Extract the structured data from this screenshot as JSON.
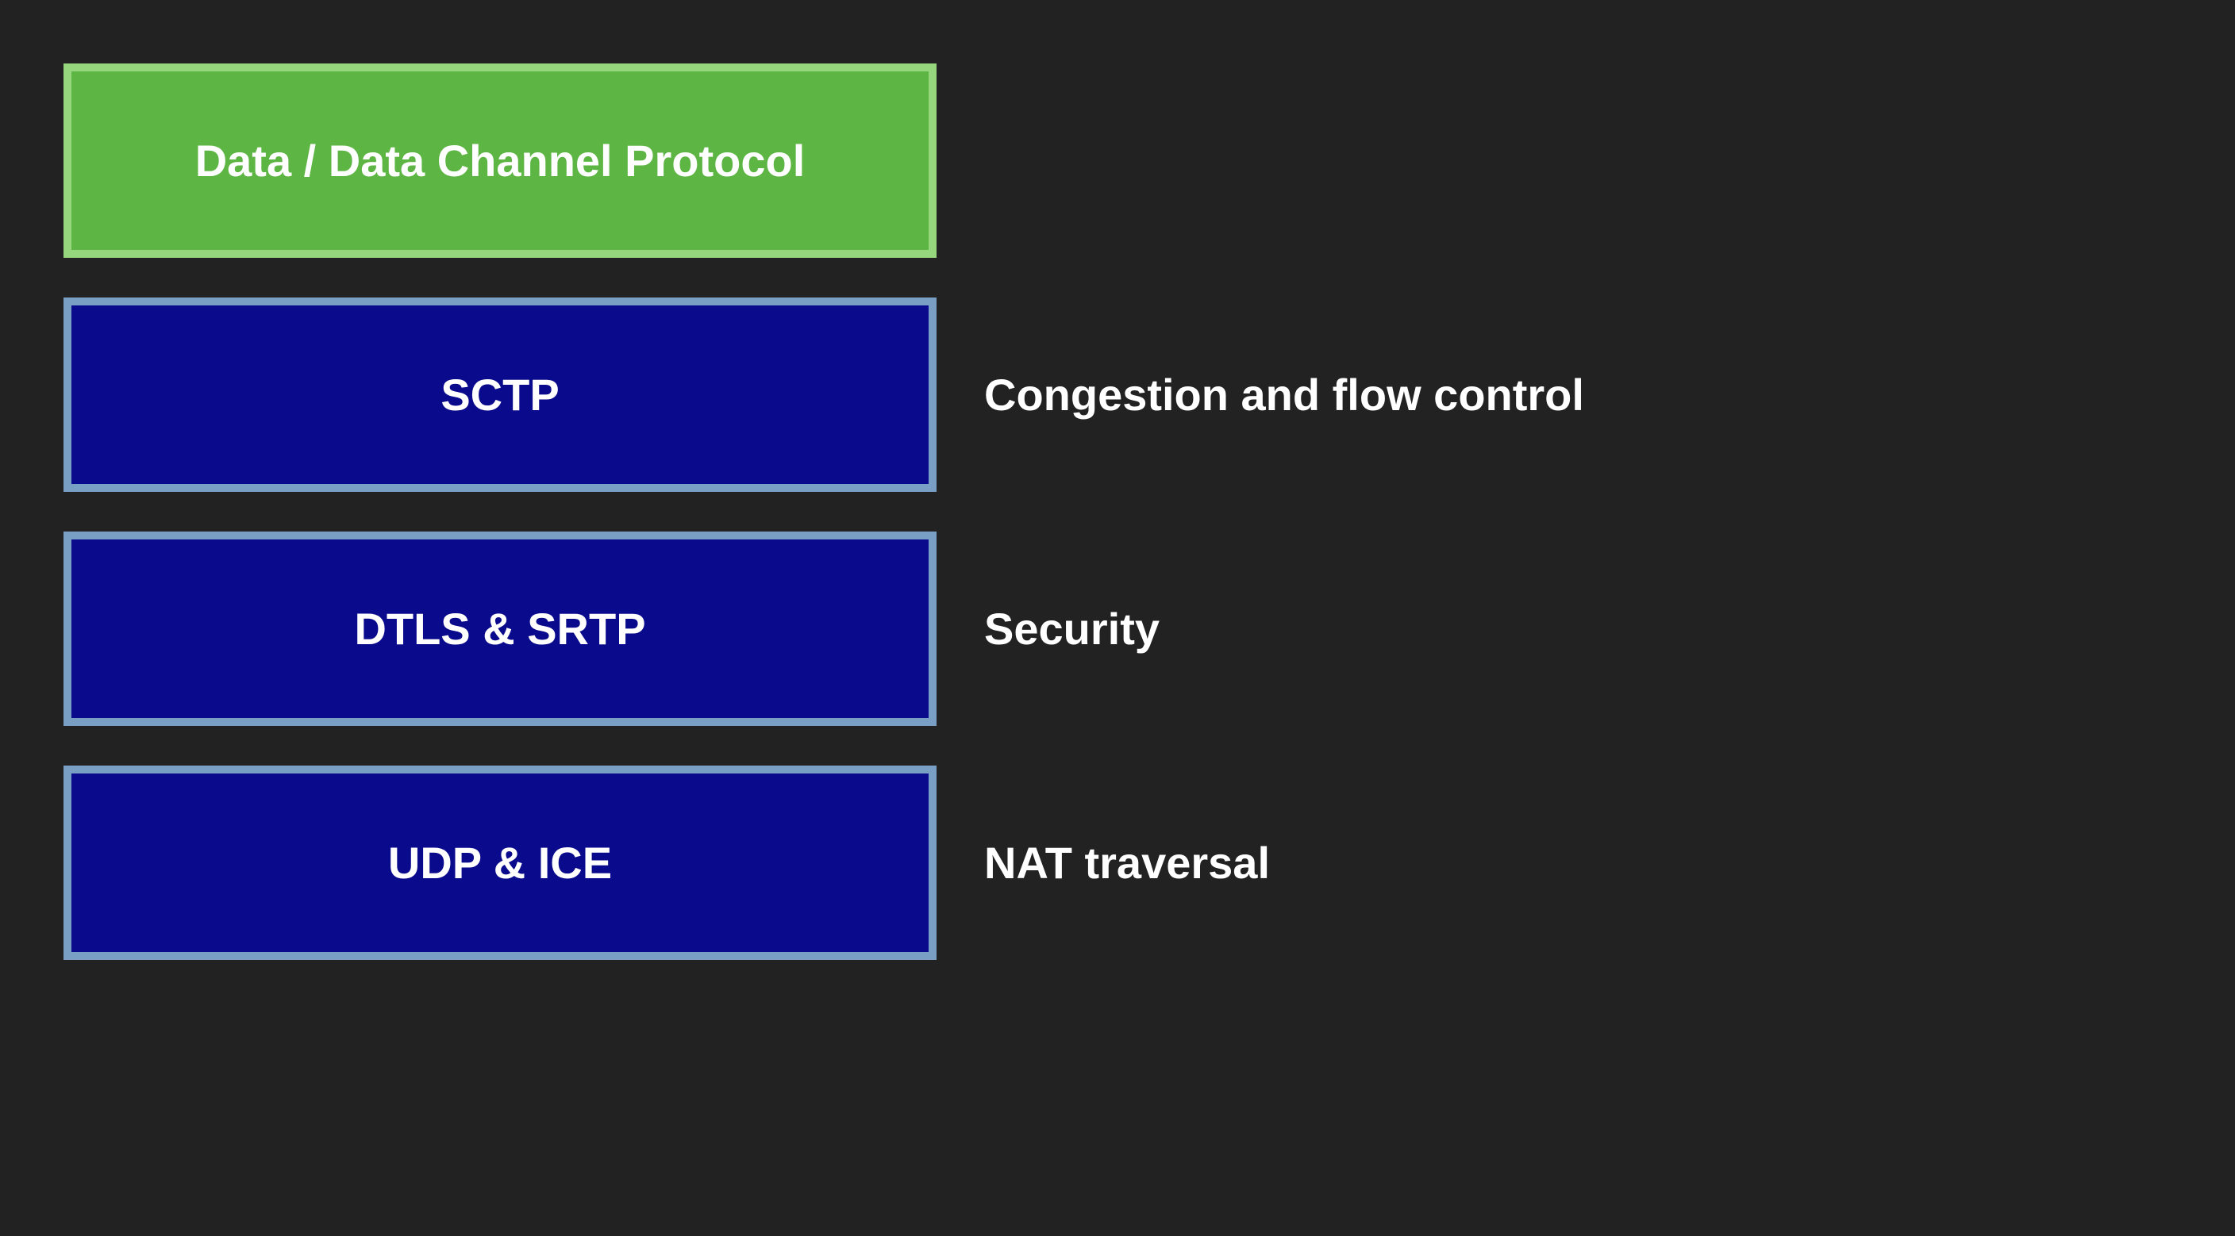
{
  "layers": [
    {
      "label": "Data / Data Channel Protocol",
      "description": "",
      "color": "green"
    },
    {
      "label": "SCTP",
      "description": "Congestion and flow control",
      "color": "blue"
    },
    {
      "label": "DTLS & SRTP",
      "description": "Security",
      "color": "blue"
    },
    {
      "label": "UDP & ICE",
      "description": "NAT traversal",
      "color": "blue"
    }
  ]
}
